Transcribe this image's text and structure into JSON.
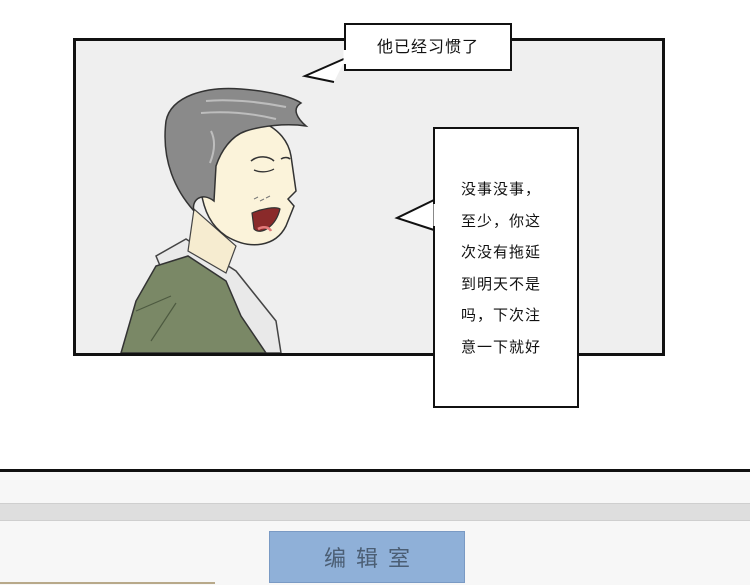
{
  "comic": {
    "speech_top": "他已经习惯了",
    "speech_right": [
      "没事没事，",
      "至少，你这",
      "次没有拖延",
      "到明天不是",
      "吗，下次注",
      "意一下就好"
    ]
  },
  "footer": {
    "editor_button_label": "编辑室"
  },
  "colors": {
    "panel_bg": "#efefef",
    "jacket": "#7a8866",
    "hair": "#8a8a8a",
    "skin": "#fbf3da",
    "button": "#8fb0d8"
  }
}
